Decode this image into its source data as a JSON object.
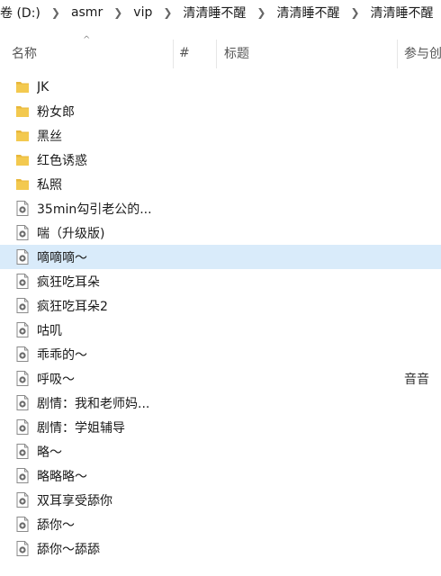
{
  "breadcrumb": [
    "卷 (D:)",
    "asmr",
    "vip",
    "清清睡不醒",
    "清清睡不醒",
    "清清睡不醒"
  ],
  "columns": {
    "sort_indicator": "^",
    "name": "名称",
    "number": "#",
    "title": "标题",
    "participant": "参与创"
  },
  "items": [
    {
      "type": "folder",
      "name": "JK",
      "participant": ""
    },
    {
      "type": "folder",
      "name": "粉女郎",
      "participant": ""
    },
    {
      "type": "folder",
      "name": "黑丝",
      "participant": ""
    },
    {
      "type": "folder",
      "name": "红色诱惑",
      "participant": ""
    },
    {
      "type": "folder",
      "name": "私照",
      "participant": ""
    },
    {
      "type": "audio",
      "name": "35min勾引老公的...",
      "participant": ""
    },
    {
      "type": "audio",
      "name": "喘（升级版)",
      "participant": ""
    },
    {
      "type": "audio",
      "name": "嘀嘀嘀～",
      "participant": "",
      "selected": true
    },
    {
      "type": "audio",
      "name": "疯狂吃耳朵",
      "participant": ""
    },
    {
      "type": "audio",
      "name": "疯狂吃耳朵2",
      "participant": ""
    },
    {
      "type": "audio",
      "name": "咕叽",
      "participant": ""
    },
    {
      "type": "audio",
      "name": "乖乖的～",
      "participant": ""
    },
    {
      "type": "audio",
      "name": "呼吸～",
      "participant": "音音"
    },
    {
      "type": "audio",
      "name": "剧情：我和老师妈...",
      "participant": ""
    },
    {
      "type": "audio",
      "name": "剧情：学姐辅导",
      "participant": ""
    },
    {
      "type": "audio",
      "name": "略～",
      "participant": ""
    },
    {
      "type": "audio",
      "name": "略略略～",
      "participant": ""
    },
    {
      "type": "audio",
      "name": "双耳享受舔你",
      "participant": ""
    },
    {
      "type": "audio",
      "name": "舔你～",
      "participant": ""
    },
    {
      "type": "audio",
      "name": "舔你～舔舔",
      "participant": ""
    }
  ],
  "colors": {
    "selection": "#d9ebfa",
    "folder": "#f3c94f",
    "audio_icon": "#6b6b6b"
  }
}
